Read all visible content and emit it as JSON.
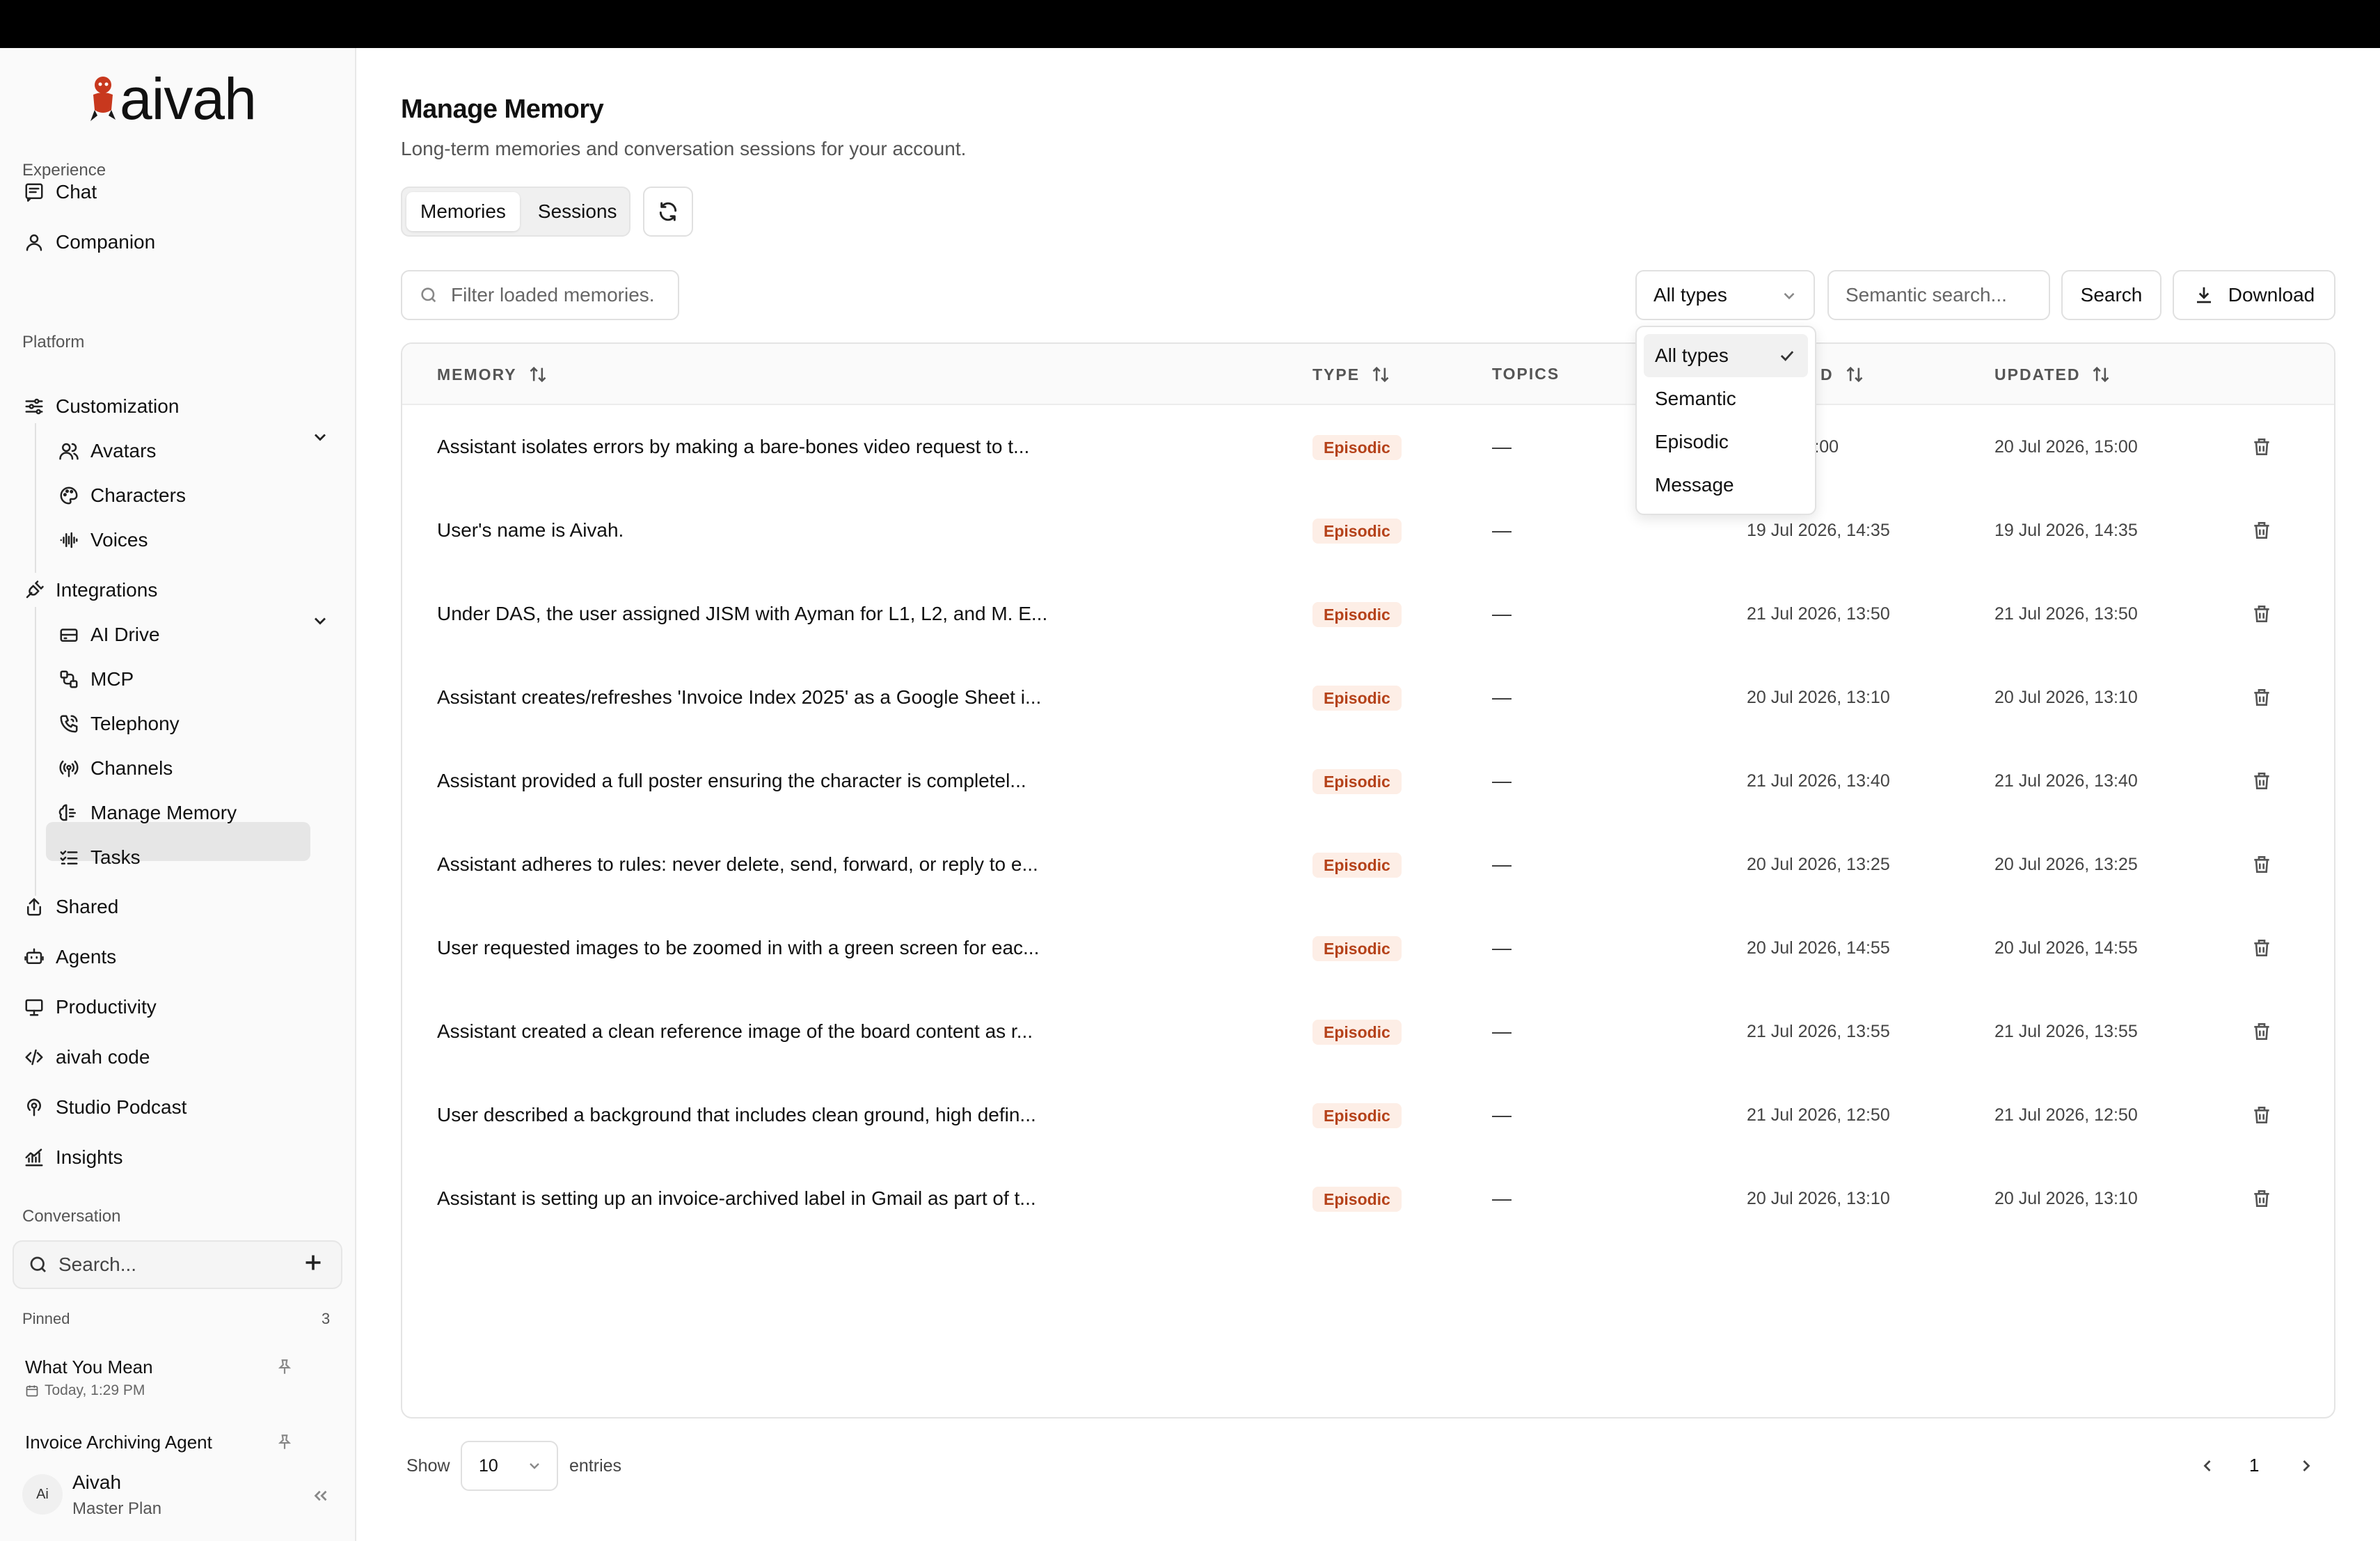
{
  "app": {
    "logo_text": "aivah"
  },
  "sidebar": {
    "sections": {
      "experience": "Experience",
      "platform": "Platform",
      "conversation": "Conversation",
      "pinned": "Pinned"
    },
    "experience_items": [
      {
        "label": "Chat",
        "icon": "chat-icon"
      },
      {
        "label": "Companion",
        "icon": "user-icon"
      }
    ],
    "customization": {
      "label": "Customization",
      "items": [
        {
          "label": "Avatars",
          "icon": "users-icon"
        },
        {
          "label": "Characters",
          "icon": "palette-icon"
        },
        {
          "label": "Voices",
          "icon": "waveform-icon"
        }
      ]
    },
    "integrations": {
      "label": "Integrations",
      "items": [
        {
          "label": "AI Drive",
          "icon": "drive-icon"
        },
        {
          "label": "MCP",
          "icon": "route-icon"
        },
        {
          "label": "Telephony",
          "icon": "phone-icon"
        },
        {
          "label": "Channels",
          "icon": "radio-icon"
        },
        {
          "label": "Manage Memory",
          "icon": "brain-icon",
          "active": true
        },
        {
          "label": "Tasks",
          "icon": "checklist-icon"
        }
      ]
    },
    "other_items": [
      {
        "label": "Shared",
        "icon": "share-icon"
      },
      {
        "label": "Agents",
        "icon": "bot-icon"
      },
      {
        "label": "Productivity",
        "icon": "presentation-icon"
      },
      {
        "label": "aivah code",
        "icon": "code-icon"
      },
      {
        "label": "Studio Podcast",
        "icon": "podcast-icon"
      },
      {
        "label": "Insights",
        "icon": "chart-icon"
      }
    ],
    "search_placeholder": "Search...",
    "pinned_count": "3",
    "pinned": [
      {
        "title": "What You Mean",
        "date": "Today, 1:29 PM"
      },
      {
        "title": "Invoice Archiving Agent"
      }
    ],
    "user": {
      "initials": "Ai",
      "name": "Aivah",
      "plan": "Master Plan"
    }
  },
  "main": {
    "title": "Manage Memory",
    "subtitle": "Long-term memories and conversation sessions for your account.",
    "tabs": [
      {
        "label": "Memories",
        "active": true
      },
      {
        "label": "Sessions",
        "active": false
      }
    ],
    "filter_placeholder": "Filter loaded memories.",
    "type_select_value": "All types",
    "semantic_placeholder": "Semantic search...",
    "search_label": "Search",
    "download_label": "Download",
    "dropdown_options": [
      {
        "label": "All types",
        "selected": true
      },
      {
        "label": "Semantic",
        "selected": false
      },
      {
        "label": "Episodic",
        "selected": false
      },
      {
        "label": "Message",
        "selected": false
      }
    ]
  },
  "table": {
    "columns": {
      "memory": "MEMORY",
      "type": "TYPE",
      "topics": "TOPICS",
      "created": "D",
      "updated": "UPDATED"
    },
    "rows": [
      {
        "memory": "Assistant isolates errors by making a bare-bones video request to t...",
        "type": "Episodic",
        "topics": "—",
        "created": "2026, 15:00",
        "updated": "20 Jul 2026, 15:00"
      },
      {
        "memory": "User's name is Aivah.",
        "type": "Episodic",
        "topics": "—",
        "created": "19 Jul 2026, 14:35",
        "updated": "19 Jul 2026, 14:35"
      },
      {
        "memory": "Under DAS, the user assigned JISM with Ayman for L1, L2, and M. E...",
        "type": "Episodic",
        "topics": "—",
        "created": "21 Jul 2026, 13:50",
        "updated": "21 Jul 2026, 13:50"
      },
      {
        "memory": "Assistant creates/refreshes 'Invoice Index 2025' as a Google Sheet i...",
        "type": "Episodic",
        "topics": "—",
        "created": "20 Jul 2026, 13:10",
        "updated": "20 Jul 2026, 13:10"
      },
      {
        "memory": "Assistant provided a full poster ensuring the character is completel...",
        "type": "Episodic",
        "topics": "—",
        "created": "21 Jul 2026, 13:40",
        "updated": "21 Jul 2026, 13:40"
      },
      {
        "memory": "Assistant adheres to rules: never delete, send, forward, or reply to e...",
        "type": "Episodic",
        "topics": "—",
        "created": "20 Jul 2026, 13:25",
        "updated": "20 Jul 2026, 13:25"
      },
      {
        "memory": "User requested images to be zoomed in with a green screen for eac...",
        "type": "Episodic",
        "topics": "—",
        "created": "20 Jul 2026, 14:55",
        "updated": "20 Jul 2026, 14:55"
      },
      {
        "memory": "Assistant created a clean reference image of the board content as r...",
        "type": "Episodic",
        "topics": "—",
        "created": "21 Jul 2026, 13:55",
        "updated": "21 Jul 2026, 13:55"
      },
      {
        "memory": "User described a background that includes clean ground, high defin...",
        "type": "Episodic",
        "topics": "—",
        "created": "21 Jul 2026, 12:50",
        "updated": "21 Jul 2026, 12:50"
      },
      {
        "memory": "Assistant is setting up an invoice-archived label in Gmail as part of t...",
        "type": "Episodic",
        "topics": "—",
        "created": "20 Jul 2026, 13:10",
        "updated": "20 Jul 2026, 13:10"
      }
    ]
  },
  "pagination": {
    "show_label": "Show",
    "page_size": "10",
    "entries_label": "entries",
    "current_page": "1"
  },
  "colors": {
    "badge_bg": "#fdeee6",
    "badge_text": "#b5421a",
    "active_nav": "#e6e6e6",
    "logo_mark": "#c8381e"
  }
}
